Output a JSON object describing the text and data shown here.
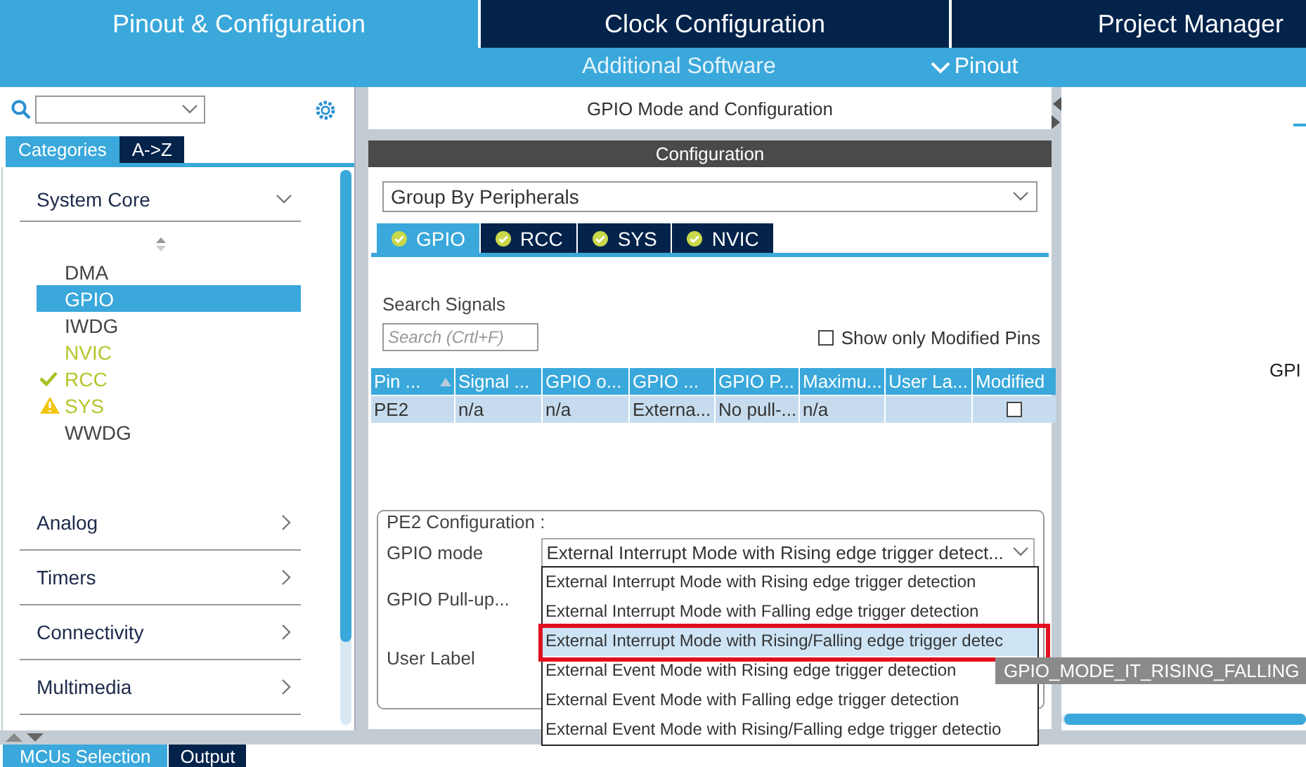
{
  "top_tabs": [
    {
      "label": "Pinout & Configuration",
      "selected": true
    },
    {
      "label": "Clock Configuration",
      "selected": false
    },
    {
      "label": "Project Manager",
      "selected": false
    }
  ],
  "sub_bar": {
    "additional": "Additional Software",
    "pinout": "Pinout"
  },
  "sidebar": {
    "tabs": [
      {
        "label": "Categories",
        "selected": true
      },
      {
        "label": "A->Z",
        "selected": false
      }
    ],
    "categories": [
      {
        "label": "System Core",
        "expanded": true,
        "items": [
          {
            "label": "DMA",
            "selected": false,
            "enabled": false,
            "ok": false,
            "warning": false
          },
          {
            "label": "GPIO",
            "selected": true,
            "enabled": false,
            "ok": false,
            "warning": false
          },
          {
            "label": "IWDG",
            "selected": false,
            "enabled": false,
            "ok": false,
            "warning": false
          },
          {
            "label": "NVIC",
            "selected": false,
            "enabled": true,
            "ok": false,
            "warning": false
          },
          {
            "label": "RCC",
            "selected": false,
            "enabled": true,
            "ok": true,
            "warning": false
          },
          {
            "label": "SYS",
            "selected": false,
            "enabled": true,
            "ok": false,
            "warning": true
          },
          {
            "label": "WWDG",
            "selected": false,
            "enabled": false,
            "ok": false,
            "warning": false
          }
        ]
      },
      {
        "label": "Analog",
        "expanded": false
      },
      {
        "label": "Timers",
        "expanded": false
      },
      {
        "label": "Connectivity",
        "expanded": false
      },
      {
        "label": "Multimedia",
        "expanded": false
      }
    ]
  },
  "panel": {
    "title": "GPIO Mode and Configuration",
    "section": "Configuration",
    "group_by": "Group By Peripherals",
    "tabs": [
      {
        "label": "GPIO",
        "selected": true
      },
      {
        "label": "RCC",
        "selected": false
      },
      {
        "label": "SYS",
        "selected": false
      },
      {
        "label": "NVIC",
        "selected": false
      }
    ],
    "search_label": "Search Signals",
    "search_placeholder": "Search (Crtl+F)",
    "show_modified": {
      "label": "Show only Modified Pins",
      "checked": false
    },
    "table": {
      "columns": [
        "Pin ...",
        "Signal ...",
        "GPIO o...",
        "GPIO ...",
        "GPIO P...",
        "Maximu...",
        "User La...",
        "Modified"
      ],
      "rows": [
        {
          "cells": [
            "PE2",
            "n/a",
            "n/a",
            "Externa...",
            "No pull-...",
            "n/a",
            ""
          ],
          "modified": false
        }
      ]
    },
    "config": {
      "legend": "PE2 Configuration :",
      "fields": [
        {
          "label": "GPIO mode",
          "value": "External Interrupt Mode with Rising edge trigger detect..."
        },
        {
          "label": "GPIO Pull-up..."
        },
        {
          "label": "User Label"
        }
      ],
      "options": [
        {
          "label": "External Interrupt Mode with Rising edge trigger detection",
          "selected": false,
          "marked": false
        },
        {
          "label": "External Interrupt Mode with Falling edge trigger detection",
          "selected": false,
          "marked": false
        },
        {
          "label": "External Interrupt Mode with Rising/Falling edge trigger detec",
          "selected": true,
          "marked": true
        },
        {
          "label": "External Event Mode with Rising edge trigger detection",
          "selected": false,
          "marked": false
        },
        {
          "label": "External Event Mode with Falling edge trigger detection",
          "selected": false,
          "marked": false
        },
        {
          "label": "External Event Mode with Rising/Falling edge trigger detectio",
          "selected": false,
          "marked": false
        }
      ],
      "tooltip": "GPIO_MODE_IT_RISING_FALLING"
    }
  },
  "canvas": {
    "pin_label": "GPI"
  },
  "bottom_tabs": [
    {
      "label": "MCUs Selection",
      "selected": true
    },
    {
      "label": "Output",
      "selected": false
    }
  ]
}
